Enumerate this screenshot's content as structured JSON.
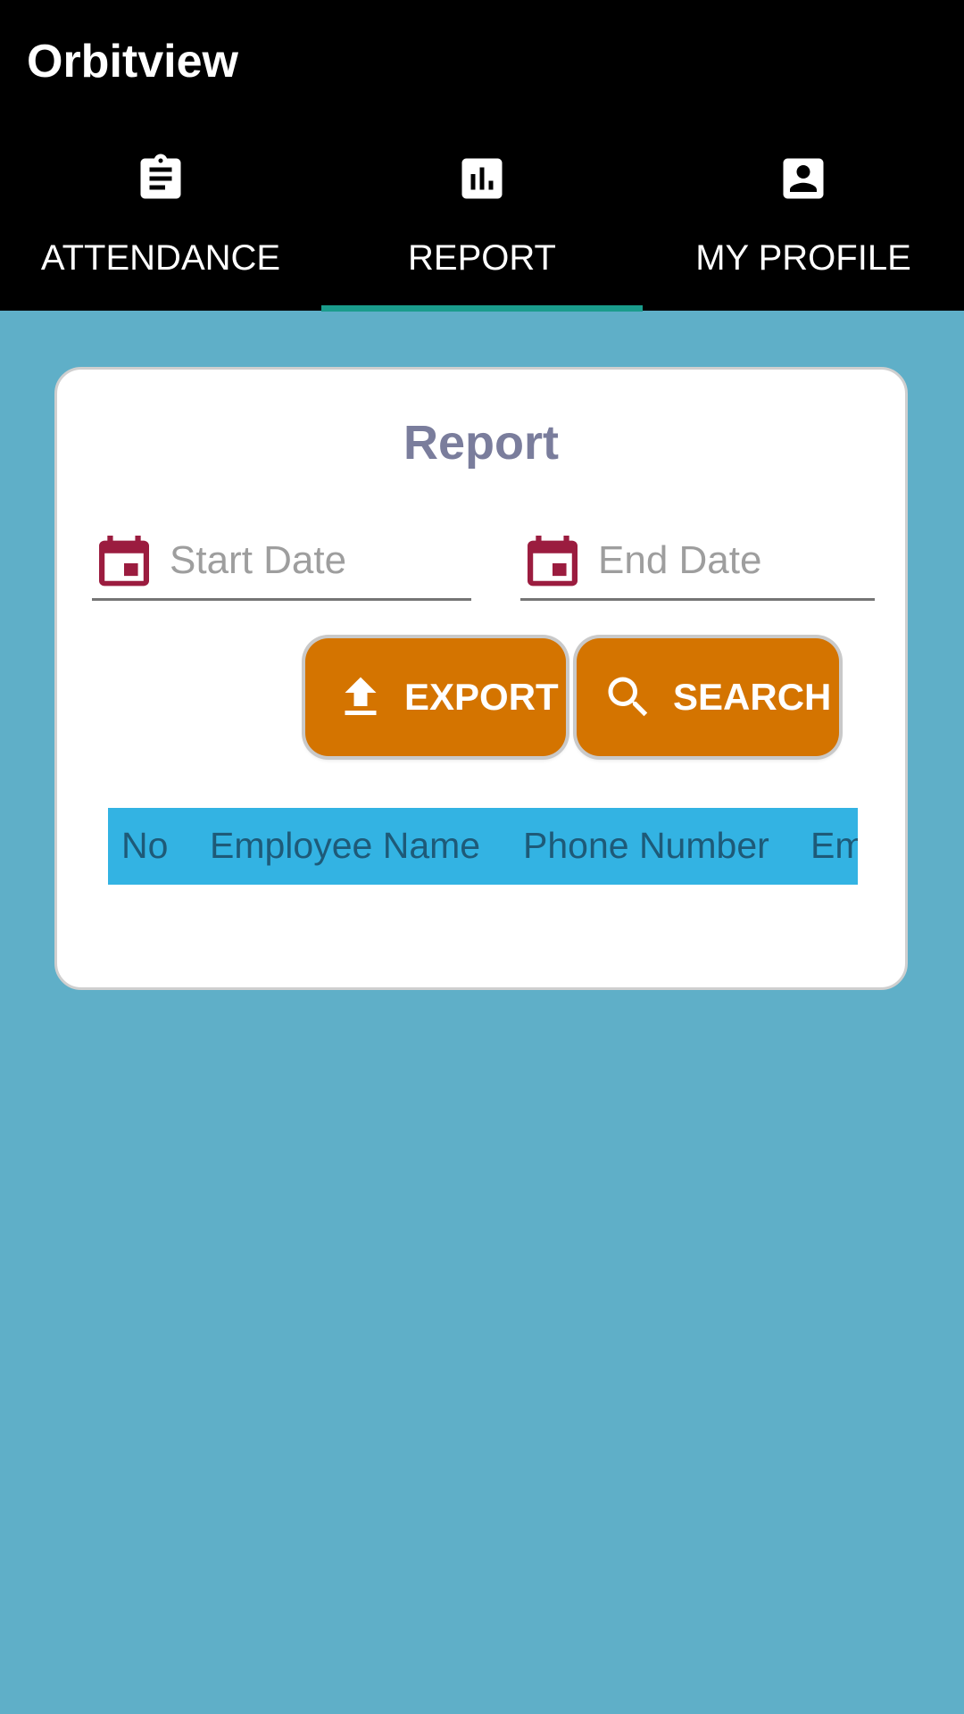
{
  "app": {
    "title": "Orbitview"
  },
  "tabs": [
    {
      "label": "ATTENDANCE",
      "icon": "clipboard-icon",
      "selected": false
    },
    {
      "label": "REPORT",
      "icon": "bar-chart-icon",
      "selected": true
    },
    {
      "label": "MY PROFILE",
      "icon": "account-box-icon",
      "selected": false
    }
  ],
  "report": {
    "title": "Report",
    "start_date": {
      "placeholder": "Start Date",
      "value": "",
      "icon": "calendar-icon"
    },
    "end_date": {
      "placeholder": "End Date",
      "value": "",
      "icon": "calendar-icon"
    },
    "export_label": "EXPORT",
    "search_label": "SEARCH",
    "table": {
      "columns": [
        "No",
        "Employee Name",
        "Phone Number",
        "Email"
      ]
    }
  },
  "colors": {
    "appbar": "#000000",
    "background": "#5fafc8",
    "tab_indicator": "#1a9c8c",
    "title": "#7a7d9c",
    "calendar_icon": "#9b1c3f",
    "button": "#d47400",
    "table_header": "#33b3e3",
    "table_header_text": "#1e5a78"
  }
}
